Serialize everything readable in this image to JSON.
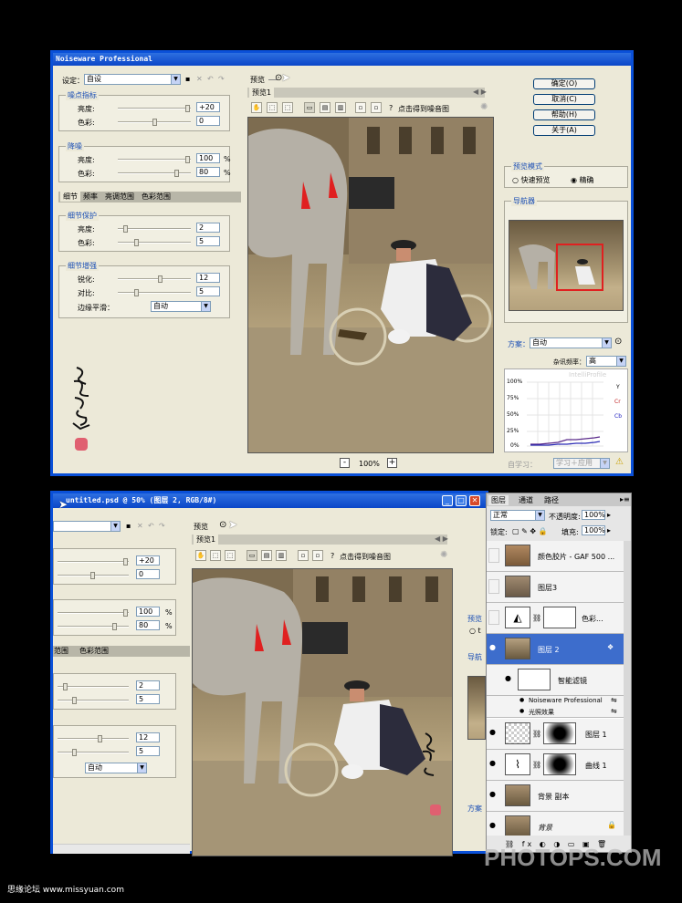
{
  "top_window": {
    "title": "Noiseware Professional",
    "settings_label": "设定：",
    "settings_value": "自设",
    "preview_label": "预览",
    "preview_tab": "预览1",
    "tool_hint": "点击得到噪音图",
    "noise_level": {
      "title": "噪点指标",
      "brightness_label": "亮度:",
      "brightness": "+20",
      "color_label": "色彩:",
      "color": "0"
    },
    "noise_reduction": {
      "title": "降噪",
      "brightness_label": "亮度:",
      "brightness": "100",
      "color_label": "色彩:",
      "color": "80",
      "unit": "%"
    },
    "tabs": [
      "细节",
      "频率",
      "亮调范围",
      "色彩范围"
    ],
    "detail_protect": {
      "title": "细节保护",
      "brightness_label": "亮度:",
      "brightness": "2",
      "color_label": "色彩:",
      "color": "5"
    },
    "detail_enhance": {
      "title": "细节增强",
      "sharpen_label": "锐化:",
      "sharpen": "12",
      "contrast_label": "对比:",
      "contrast": "5",
      "edge_label": "边缘平滑：",
      "edge_value": "自动"
    },
    "buttons": {
      "ok": "确定(O)",
      "cancel": "取消(C)",
      "help": "帮助(H)",
      "about": "关于(A)"
    },
    "preview_mode": {
      "title": "预览模式",
      "fast": "快速预览",
      "accurate": "精确"
    },
    "navigator_title": "导航器",
    "scheme_label": "方案：",
    "scheme_value": "自动",
    "noise_freq_label": "杂讯频率：",
    "noise_freq_value": "高",
    "graph_labels": [
      "100%",
      "75%",
      "50%",
      "25%",
      "0%"
    ],
    "graph_watermark": "IntelliProfile",
    "graph_legend": [
      "Y",
      "Cr",
      "Cb"
    ],
    "learn_label": "自学习：",
    "learn_value": "学习＋应用",
    "zoom": "100%",
    "zoom_minus": "-",
    "zoom_plus": "+"
  },
  "bottom_window": {
    "title": "untitled.psd @ 50% (图层 2, RGB/8#)",
    "preview_label": "预览",
    "preview_tab": "预览1",
    "tool_hint": "点击得到噪音图",
    "values": [
      "+20",
      "0",
      "100",
      "80",
      "2",
      "5",
      "12",
      "5"
    ],
    "unit": "%",
    "tabs_partial": [
      "范围",
      "色彩范围"
    ],
    "edge_value": "自动",
    "preview_mode_partial": "预览",
    "radio_partial": "t",
    "navigator_partial": "导航",
    "scheme_partial": "方案"
  },
  "layers_panel": {
    "tabs": [
      "图层",
      "通道",
      "路径"
    ],
    "blend_mode": "正常",
    "opacity_label": "不透明度:",
    "opacity": "100%",
    "lock_label": "锁定:",
    "fill_label": "填充:",
    "fill": "100%",
    "layers": [
      {
        "name": "颜色胶片 - GAF 500 ..."
      },
      {
        "name": "图层3"
      },
      {
        "name": "色彩..."
      },
      {
        "name": "图层 2",
        "selected": true
      },
      {
        "name": "智能滤镜"
      },
      {
        "name": "Noiseware Professional"
      },
      {
        "name": "光照效果"
      },
      {
        "name": "图层 1"
      },
      {
        "name": "曲线 1"
      },
      {
        "name": "背景 副本"
      },
      {
        "name": "背景"
      }
    ]
  },
  "signature_text": "飞鸿踏雪印",
  "watermark_left": "思缘论坛 www.missyuan.com",
  "watermark_right": "PHOTOPS.COM",
  "colors": {
    "xp_blue": "#0a50d8",
    "dialog_bg": "#ece9d8",
    "accent_red": "#e02020",
    "ps_selected": "#3d6dcc"
  }
}
